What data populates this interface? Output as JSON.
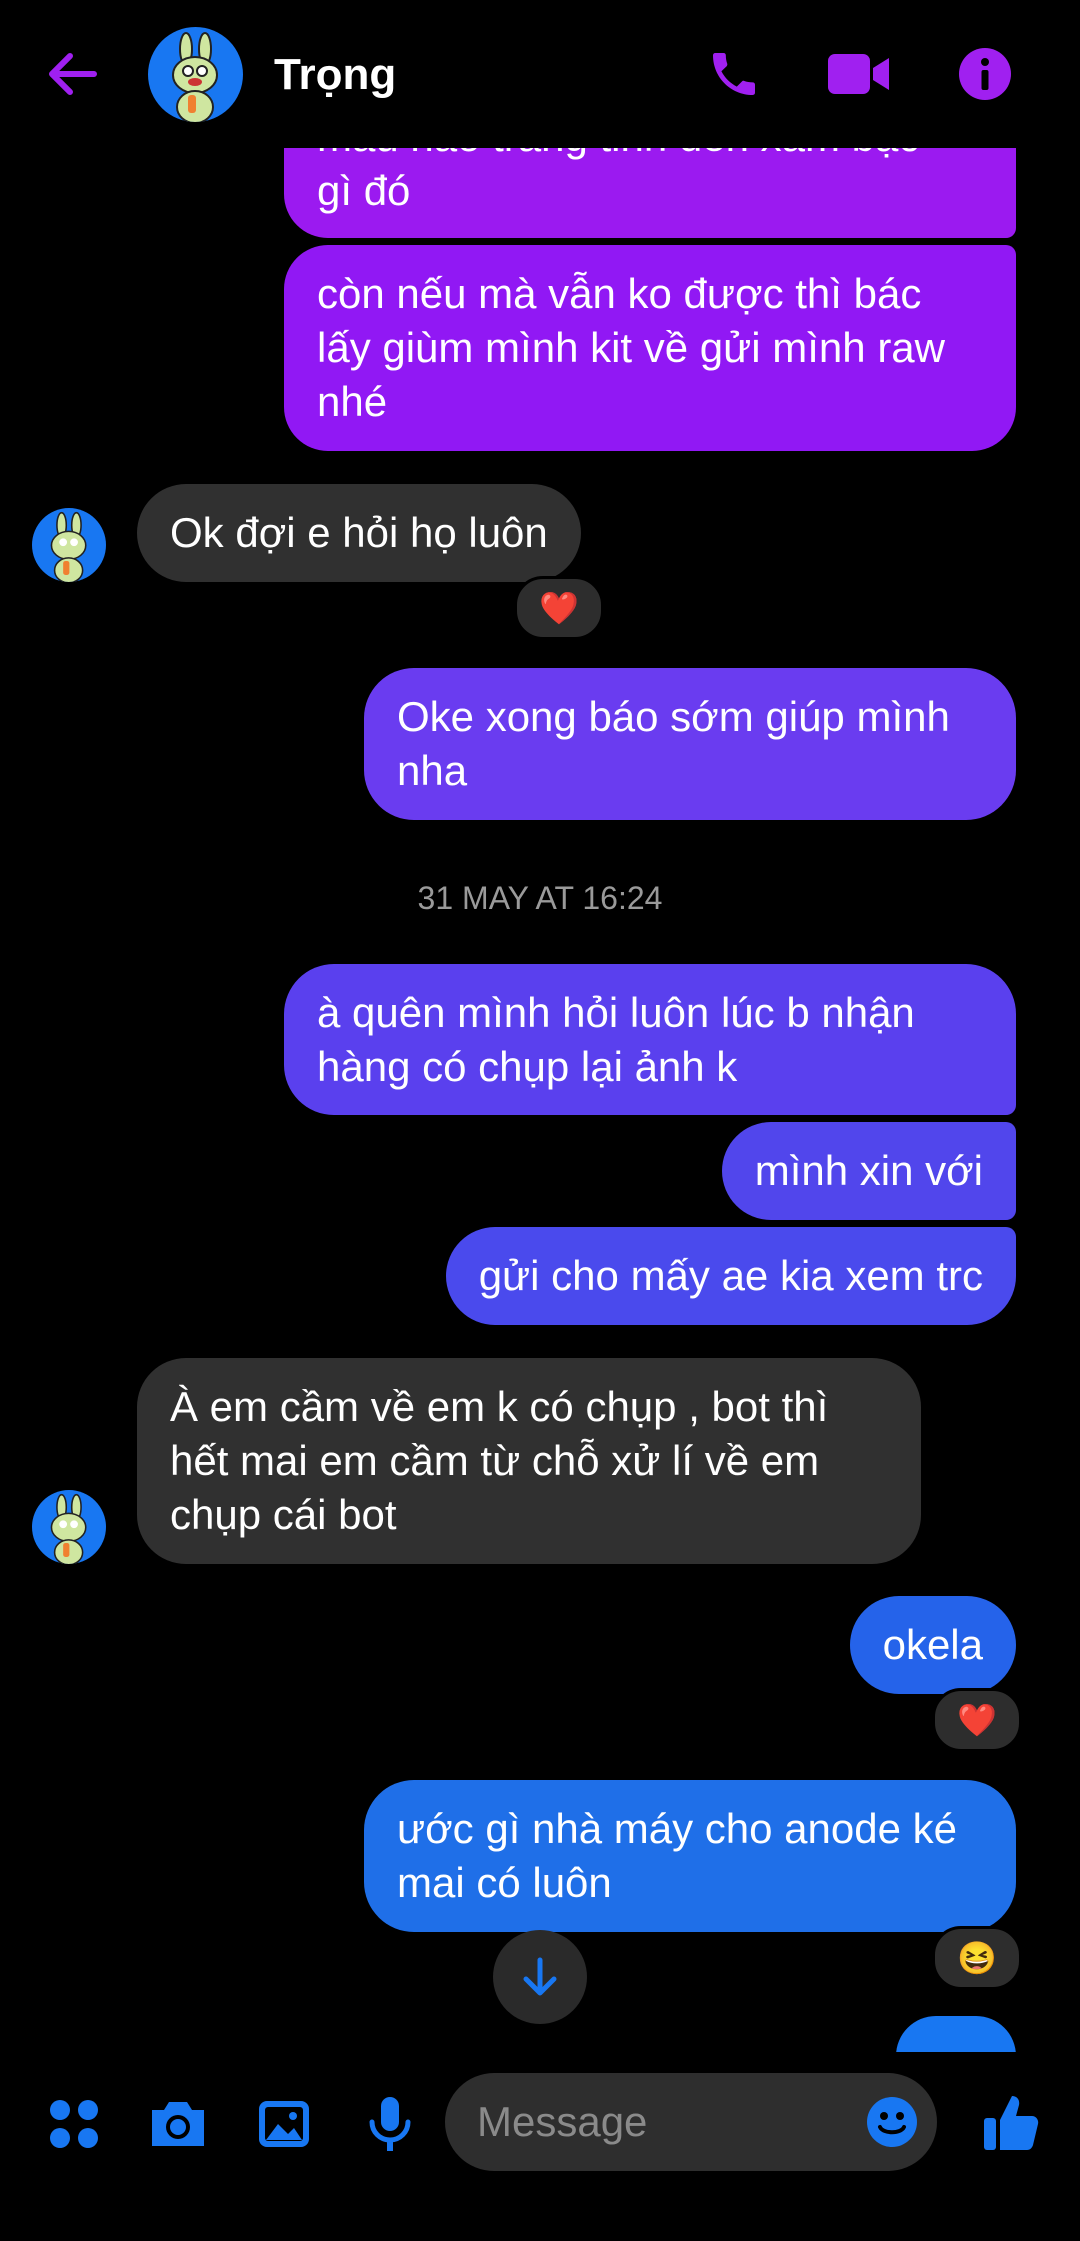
{
  "header": {
    "contact_name": "Trọng",
    "accent_color": "#a020f0"
  },
  "messages": {
    "m1_partial": "màu nào trắng tinh đến xám bạc",
    "m1_tail": "gì đó",
    "m2": "còn nếu mà vẫn ko được thì bác lấy giùm mình kit về gửi mình raw nhé",
    "m3": "Ok đợi e hỏi họ luôn",
    "m4": "Oke xong báo sớm giúp mình nha",
    "timestamp": "31 MAY AT 16:24",
    "m5": "à quên mình hỏi luôn lúc b nhận hàng có chụp lại ảnh k",
    "m6": "mình xin với",
    "m7": "gửi cho mấy ae kia xem trc",
    "m8": "À em cầm về em k có chụp , bot thì hết mai em cầm từ chỗ xử lí về em chụp cái bot",
    "m9": "okela",
    "m10": "ước gì nhà máy cho anode ké mai có luôn"
  },
  "reactions": {
    "r1": "❤️",
    "r2": "❤️",
    "r3": "😆"
  },
  "composer": {
    "placeholder": "Message"
  },
  "icons": [
    "back-arrow-icon",
    "phone-icon",
    "video-camera-icon",
    "info-icon",
    "apps-icon",
    "camera-icon",
    "gallery-icon",
    "microphone-icon",
    "emoji-icon",
    "thumbs-up-icon",
    "scroll-down-arrow-icon"
  ],
  "colors": {
    "bubble_purple": "#9b1af0",
    "bubble_violet": "#6a3cf0",
    "bubble_indigo": "#5147ec",
    "bubble_blue": "#1f6fe8",
    "incoming": "#303030",
    "composer_icon_blue": "#1877f2"
  }
}
